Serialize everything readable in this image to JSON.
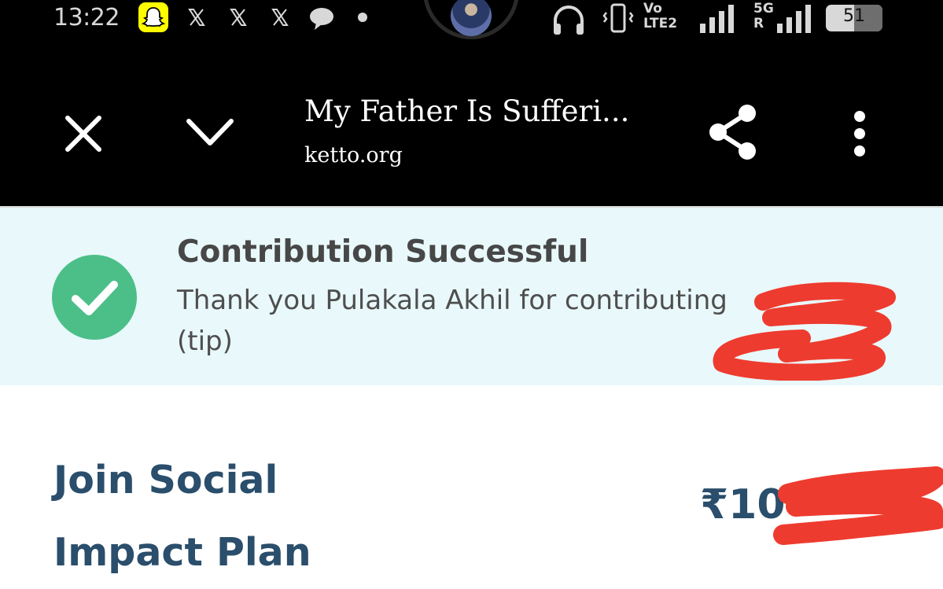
{
  "status_bar": {
    "time": "13:22",
    "network_1": "Vo LTE2",
    "network_2": "5G R",
    "battery": "51"
  },
  "toolbar": {
    "title": "My Father Is Sufferi...",
    "domain": "ketto.org"
  },
  "banner": {
    "heading": "Contribution Successful",
    "message": "Thank you Pulakala Akhil for contributing",
    "message_tail": "(tip)",
    "accent": "#4cbf89"
  },
  "plan": {
    "title_line1": "Join Social",
    "title_line2": "Impact Plan",
    "price": "₹10"
  },
  "colors": {
    "bar": "#000000",
    "banner_bg": "#e9f8fa",
    "plan_text": "#2a4e6b",
    "redaction": "#ee3b2f"
  }
}
